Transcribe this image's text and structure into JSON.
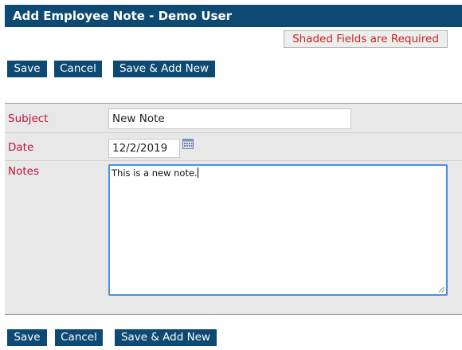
{
  "header": {
    "title": "Add Employee Note - Demo User"
  },
  "required_notice": "Shaded Fields are Required",
  "toolbar_top": {
    "save": "Save",
    "cancel": "Cancel",
    "save_add_new": "Save & Add New"
  },
  "form": {
    "subject": {
      "label": "Subject",
      "value": "New Note"
    },
    "date": {
      "label": "Date",
      "value": "12/2/2019"
    },
    "notes": {
      "label": "Notes",
      "value": "This is a new note."
    }
  },
  "toolbar_bottom": {
    "save": "Save",
    "cancel": "Cancel",
    "save_add_new": "Save & Add New"
  },
  "colors": {
    "header_bg": "#0d4a73",
    "button_bg": "#0d4a73",
    "label_red": "#c0143c",
    "required_red": "#cc1f1f",
    "row_bg": "#e8e8e8",
    "focus_border": "#4f90d9"
  },
  "icons": {
    "date_picker": "calendar-icon",
    "resize": "resize-grip-icon"
  }
}
